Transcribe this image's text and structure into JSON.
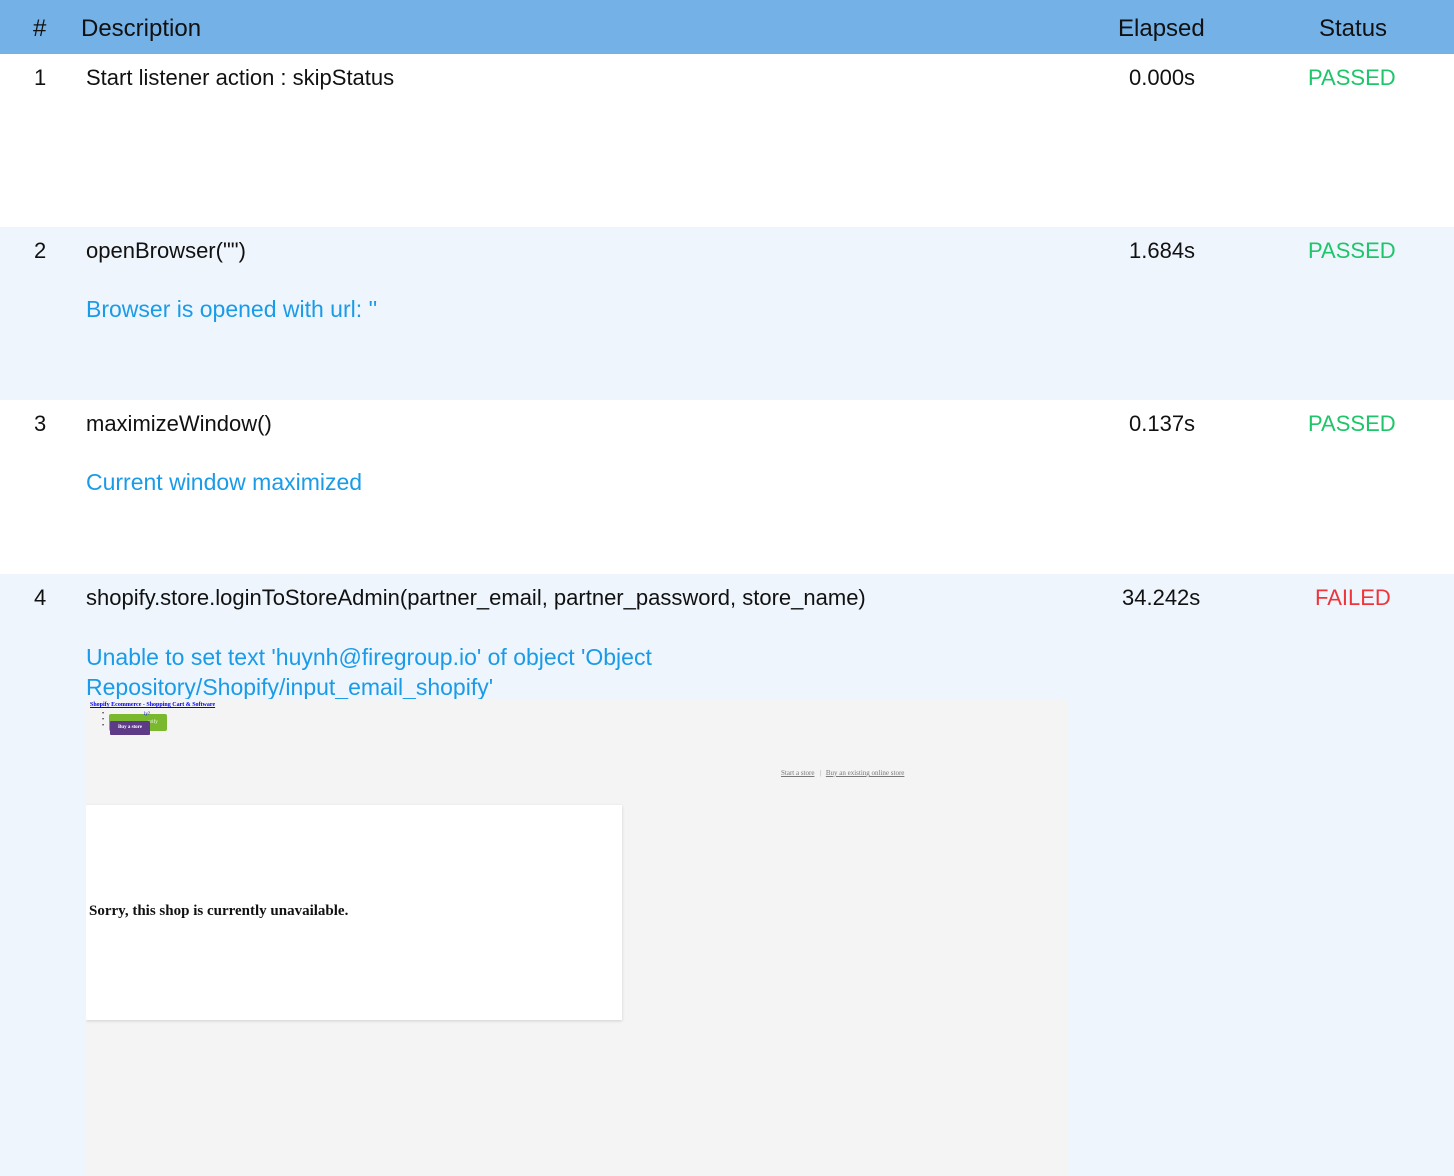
{
  "header": {
    "num": "#",
    "description": "Description",
    "elapsed": "Elapsed",
    "status": "Status"
  },
  "rows": [
    {
      "num": "1",
      "description": "Start listener action : skipStatus",
      "elapsed": "0.000s",
      "status": "PASSED",
      "message": ""
    },
    {
      "num": "2",
      "description": "openBrowser(\"\")",
      "elapsed": "1.684s",
      "status": "PASSED",
      "message": "Browser is opened with url: ''"
    },
    {
      "num": "3",
      "description": "maximizeWindow()",
      "elapsed": "0.137s",
      "status": "PASSED",
      "message": "Current window maximized"
    },
    {
      "num": "4",
      "description": "shopify.store.loginToStoreAdmin(partner_email, partner_password, store_name)",
      "elapsed": "34.242s",
      "status": "FAILED",
      "message_line1": "Unable to set text 'huynh@firegroup.io' of object 'Object",
      "message_line2": "Repository/Shopify/input_email_shopify'"
    }
  ],
  "screenshot": {
    "top_link": "Shopify Ecommerce - Shopping Cart & Software",
    "green_button_text": "ly?",
    "green_button_label": "urify",
    "purple_button": "Buy a store",
    "link_start": "Start a store",
    "link_separator": "|",
    "link_buy": "Buy an existing online store",
    "card_message": "Sorry, this shop is currently unavailable."
  },
  "colors": {
    "header_bg": "#73b1e6",
    "passed": "#1ec56a",
    "failed": "#f0353a",
    "message": "#1a9be8",
    "alt_row_bg": "#eef5fd"
  }
}
